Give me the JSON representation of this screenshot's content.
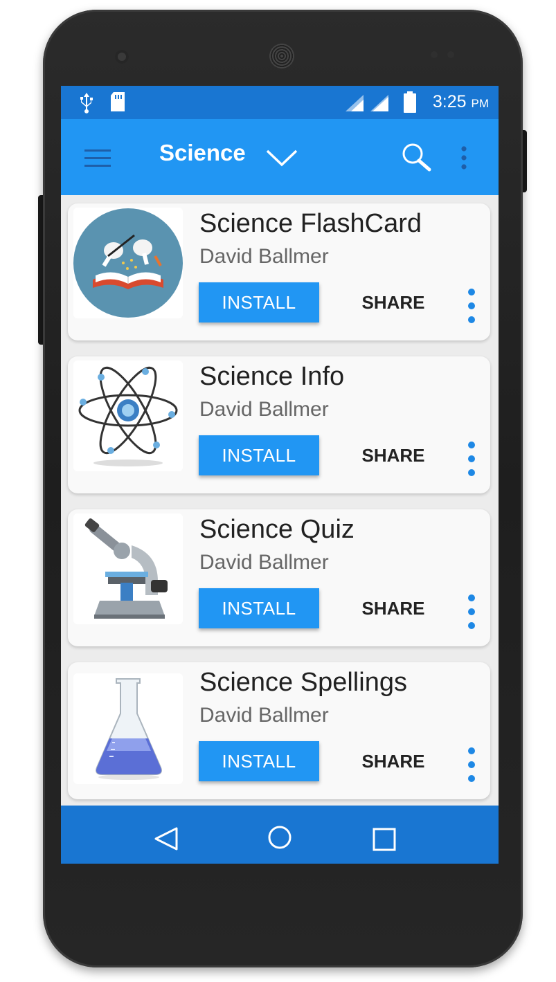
{
  "status_bar": {
    "time": "3:25",
    "ampm": "PM",
    "icons": [
      "usb-icon",
      "sd-card-icon",
      "signal-icon",
      "signal-icon",
      "battery-icon"
    ]
  },
  "toolbar": {
    "title": "Science",
    "icons": [
      "menu-icon",
      "chevron-down-icon",
      "search-icon",
      "more-vert-icon"
    ]
  },
  "apps": [
    {
      "title": "Science FlashCard",
      "developer": "David Ballmer",
      "install_label": "INSTALL",
      "share_label": "SHARE",
      "icon": "magic-book-icon"
    },
    {
      "title": "Science Info",
      "developer": "David Ballmer",
      "install_label": "INSTALL",
      "share_label": "SHARE",
      "icon": "atom-icon"
    },
    {
      "title": "Science Quiz",
      "developer": "David Ballmer",
      "install_label": "INSTALL",
      "share_label": "SHARE",
      "icon": "microscope-icon"
    },
    {
      "title": "Science Spellings",
      "developer": "David Ballmer",
      "install_label": "INSTALL",
      "share_label": "SHARE",
      "icon": "flask-icon"
    }
  ],
  "nav_bar": {
    "icons": [
      "back-icon",
      "home-icon",
      "recents-icon"
    ]
  },
  "colors": {
    "primary": "#2196f3",
    "primary_dark": "#1976d2",
    "accent_dots": "#1e88e5"
  }
}
